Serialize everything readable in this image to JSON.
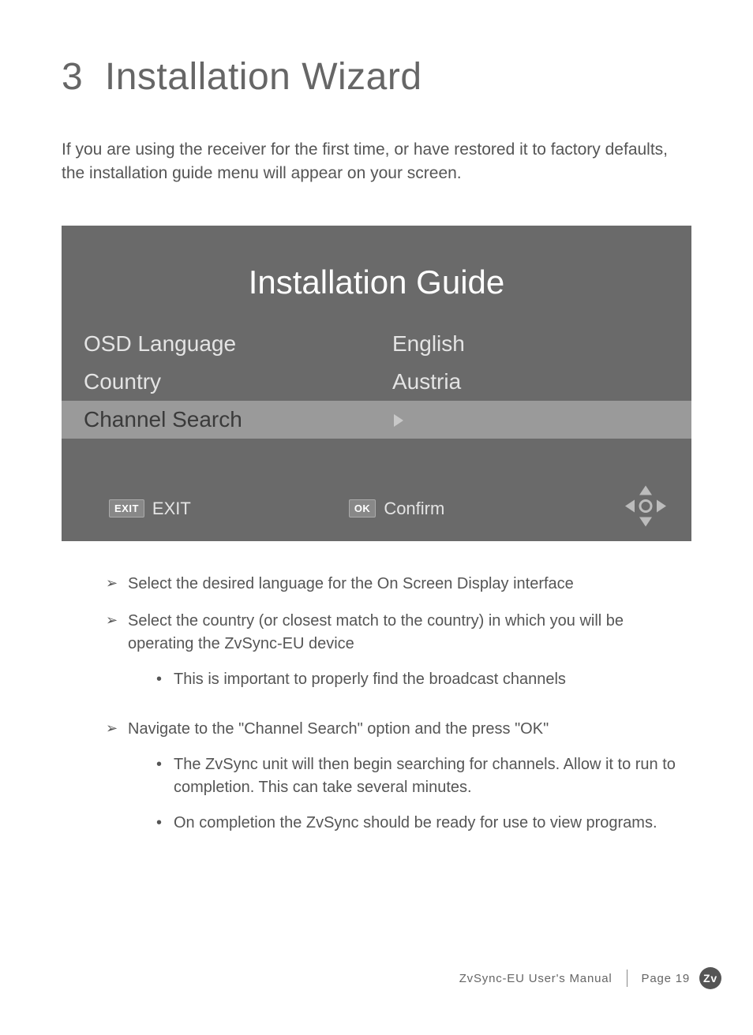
{
  "chapter": {
    "number": "3",
    "title": "Installation Wizard"
  },
  "intro": "If you are using the receiver for the first time, or have restored it to factory defaults, the installation guide menu will appear on your screen.",
  "screen": {
    "title": "Installation Guide",
    "rows": [
      {
        "label": "OSD Language",
        "value": "English"
      },
      {
        "label": "Country",
        "value": "Austria"
      },
      {
        "label": "Channel Search",
        "value": ""
      }
    ],
    "footer": {
      "exit_badge": "EXIT",
      "exit_label": "EXIT",
      "ok_badge": "OK",
      "confirm_label": "Confirm"
    }
  },
  "bullets": [
    {
      "text": "Select the desired language for the On Screen Display interface",
      "subs": []
    },
    {
      "text": "Select the country (or closest match to the country) in which you will be operating the ZvSync-EU device",
      "subs": [
        "This is important to properly find the broadcast channels"
      ]
    },
    {
      "text": "Navigate to the \"Channel Search\" option and the press \"OK\"",
      "subs": [
        "The ZvSync unit will then begin searching for channels.  Allow it to run to completion. This can take several minutes.",
        "On completion the ZvSync should be ready for use to view programs."
      ]
    }
  ],
  "footer": {
    "manual": "ZvSync-EU User's Manual",
    "page_label": "Page 19",
    "logo": "Zv"
  }
}
